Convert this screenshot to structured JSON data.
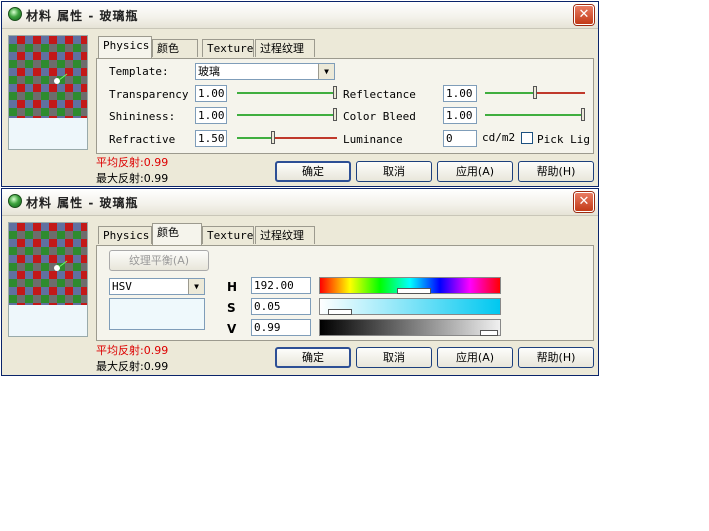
{
  "colors": {
    "accent_red": "#dd0000",
    "slider_green": "#3fae3f",
    "slider_red": "#c0392b",
    "close_red": "#d1502f"
  },
  "window1": {
    "title": "材料 属性 - 玻璃瓶",
    "close_icon": "close-icon",
    "tabs": [
      "Physics",
      "颜色",
      "Texture",
      "过程纹理"
    ],
    "active_tab": "Physics",
    "template_label": "Template:",
    "template_value": "玻璃",
    "rows": {
      "transparency": {
        "label": "Transparency",
        "value": "1.00",
        "level": 1.0
      },
      "reflectance": {
        "label": "Reflectance",
        "value": "1.00",
        "level": 0.5
      },
      "shininess": {
        "label": "Shininess:",
        "value": "1.00",
        "level": 1.0
      },
      "color_bleed": {
        "label": "Color Bleed",
        "value": "1.00",
        "level": 1.0
      },
      "refractive": {
        "label": "Refractive",
        "value": "1.50",
        "level": 0.35
      },
      "luminance": {
        "label": "Luminance",
        "value": "0",
        "unit": "cd/m2",
        "pick_label": "Pick Lig"
      }
    },
    "avg_reflect": "平均反射:0.99",
    "max_reflect": "最大反射:0.99",
    "buttons": {
      "ok": "确定",
      "cancel": "取消",
      "apply": "应用(A)",
      "help": "帮助(H)"
    }
  },
  "window2": {
    "title": "材料 属性 - 玻璃瓶",
    "close_icon": "close-icon",
    "tabs": [
      "Physics",
      "颜色",
      "Texture",
      "过程纹理"
    ],
    "active_tab": "颜色",
    "texture_balance_button": "纹理平衡(A)",
    "color_model": "HSV",
    "h_label": "H",
    "h_value": "192.00",
    "h_level": 0.53,
    "s_label": "S",
    "s_value": "0.05",
    "s_level": 0.05,
    "v_label": "V",
    "v_value": "0.99",
    "v_level": 0.99,
    "swatch_color": "#eff9fc",
    "avg_reflect": "平均反射:0.99",
    "max_reflect": "最大反射:0.99",
    "buttons": {
      "ok": "确定",
      "cancel": "取消",
      "apply": "应用(A)",
      "help": "帮助(H)"
    }
  }
}
